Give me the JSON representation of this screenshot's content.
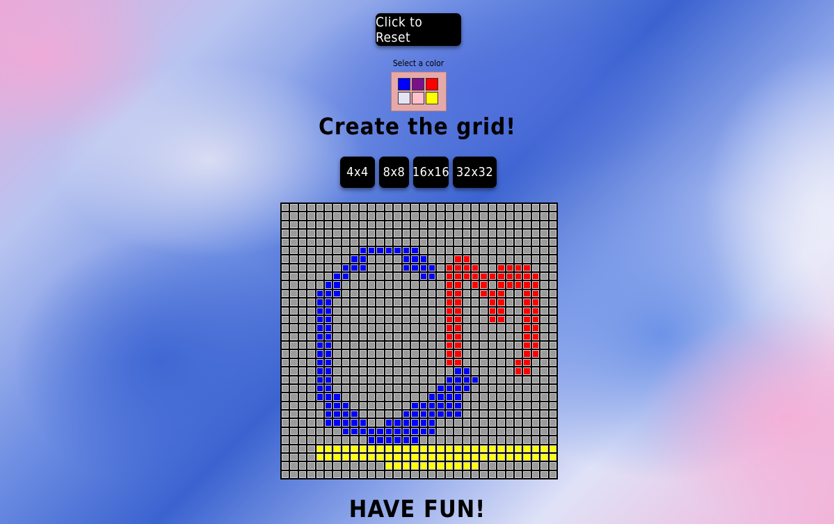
{
  "reset_label": "Click to Reset",
  "palette": {
    "label": "Select a color",
    "colors": [
      "#0000ff",
      "#7b0f8c",
      "#ff0000",
      "#e3e3f5",
      "#ffc0cb",
      "#ffff00"
    ]
  },
  "title": "Create the grid!",
  "size_buttons": [
    "4x4",
    "8x8",
    "16x16",
    "32x32"
  ],
  "grid": {
    "size": 32,
    "default_color": "#9b9b9b",
    "colored_cells": {
      "blue": "#0000ff",
      "red": "#ff0000",
      "yellow": "#ffff00"
    }
  },
  "footer": "HAVE FUN!"
}
